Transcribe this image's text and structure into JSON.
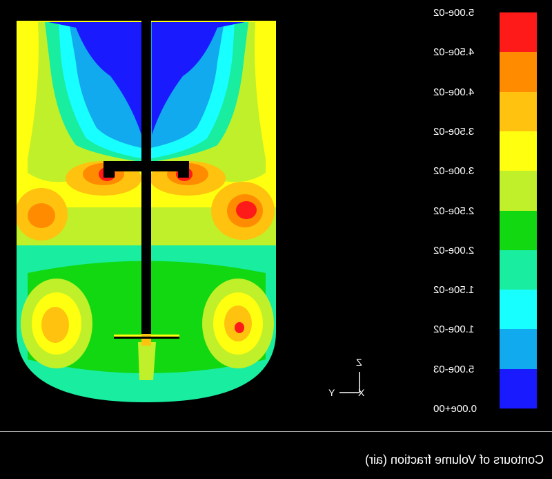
{
  "caption": "Contours of Volume fraction (air)",
  "colorbar": {
    "labels": [
      "5.00e-02",
      "4.50e-02",
      "4.00e-02",
      "3.50e-02",
      "3.00e-02",
      "2.50e-02",
      "2.00e-02",
      "1.50e-02",
      "1.00e-02",
      "5.00e-03",
      "0.00e+00"
    ],
    "colors": [
      "#ff1a1a",
      "#ff8c00",
      "#ffc20e",
      "#ffff10",
      "#bff02a",
      "#12d812",
      "#19eda0",
      "#18ffff",
      "#12aaee",
      "#1a1aff"
    ]
  },
  "axes": {
    "vertical": "Z",
    "horizontal": "Y",
    "normal": "X"
  }
}
